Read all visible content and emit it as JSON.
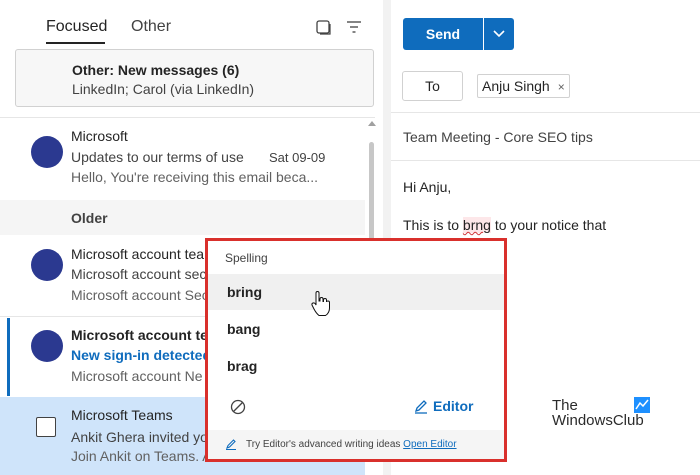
{
  "inbox": {
    "tabs": {
      "focused": "Focused",
      "other": "Other"
    },
    "other_banner": {
      "title": "Other: New messages (6)",
      "senders": "LinkedIn; Carol (via LinkedIn)"
    },
    "older_label": "Older",
    "messages": [
      {
        "sender": "Microsoft",
        "subject": "Updates to our terms of use",
        "date": "Sat 09-09",
        "preview": "Hello, You're receiving this email beca..."
      },
      {
        "sender": "Microsoft account tea",
        "subject": "Microsoft account sec",
        "preview": "Microsoft account Sec"
      },
      {
        "sender": "Microsoft account tea",
        "subject": "New sign-in detected",
        "preview": "Microsoft account Ne"
      },
      {
        "sender": "Microsoft Teams",
        "subject": "Ankit Ghera invited yo",
        "preview": "Join Ankit on Teams. A"
      }
    ]
  },
  "compose": {
    "send_label": "Send",
    "to_label": "To",
    "recipient": "Anju Singh",
    "recipient_remove": "×",
    "subject": "Team Meeting - Core SEO tips",
    "greeting": "Hi Anju,",
    "body_before": "This is to ",
    "misspelled_word": "brng",
    "body_after": " to your notice that"
  },
  "spelling_popup": {
    "title": "Spelling",
    "suggestions": [
      "bring",
      "bang",
      "brag"
    ],
    "editor_label": "Editor",
    "footer_text": "Try Editor's advanced writing ideas",
    "footer_link": "Open Editor"
  },
  "watermark": {
    "line1": "The",
    "line2": "WindowsClub"
  },
  "colors": {
    "accent": "#0f6cbd",
    "avatar": "#2b3990",
    "highlight_frame": "#d9302c",
    "selected_row": "#cfe4fa"
  },
  "icons": [
    "select-mode-icon",
    "filter-icon",
    "chevron-down-icon",
    "ignore-icon",
    "editor-pen-icon",
    "hand-pointer-icon"
  ]
}
